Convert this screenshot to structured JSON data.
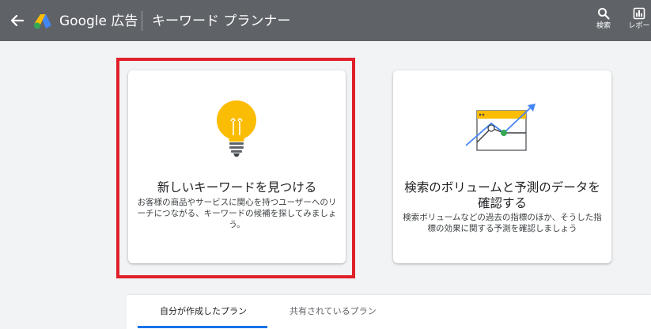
{
  "header": {
    "brand": "Google 広告",
    "tool_name": "キーワード プランナー",
    "search_label": "検索",
    "report_label": "レポー",
    "background": "#5f6368"
  },
  "cards": [
    {
      "title": "新しいキーワードを見つける",
      "description": "お客様の商品やサービスに関心を持つユーザーへのリーチにつながる、キーワードの候補を探してみましょう。",
      "icon": "lightbulb-icon",
      "selected": true
    },
    {
      "title": "検索のボリュームと予測のデータを確認する",
      "description": "検索ボリュームなどの過去の指標のほか、そうした指標の効果に関する予測を確認しましょう",
      "icon": "trend-chart-icon",
      "selected": false
    }
  ],
  "tabs": [
    {
      "label": "自分が作成したプラン",
      "active": true
    },
    {
      "label": "共有されているプラン",
      "active": false
    }
  ],
  "colors": {
    "highlight": "#e0202a",
    "accent_yellow": "#fbbc04",
    "accent_blue": "#4285f4",
    "accent_green": "#34a853",
    "tab_indicator": "#1a73e8"
  }
}
